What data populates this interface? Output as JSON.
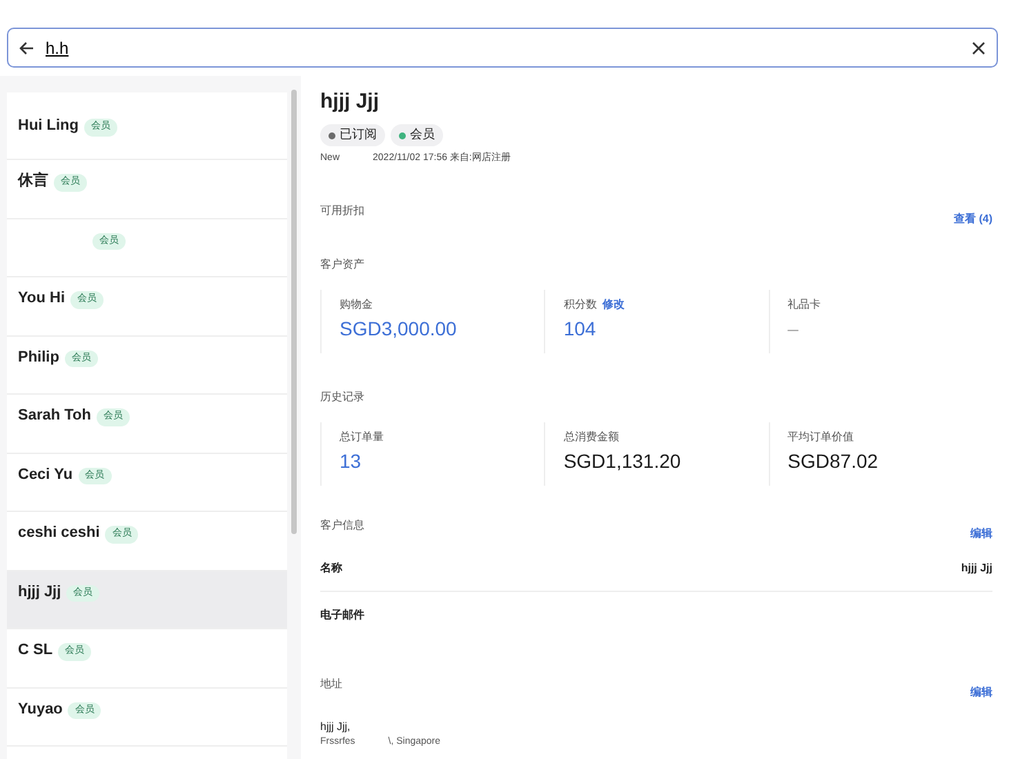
{
  "search": {
    "value": "h.h"
  },
  "customers": [
    {
      "name": "Hui Ling",
      "badge": "会员",
      "selected": false
    },
    {
      "name": "休言",
      "badge": "会员",
      "selected": false
    },
    {
      "badge": "会员",
      "selected": false
    },
    {
      "name": "You Hi",
      "badge": "会员",
      "selected": false
    },
    {
      "name": "Philip",
      "badge": "会员",
      "selected": false
    },
    {
      "name": "Sarah Toh",
      "badge": "会员",
      "selected": false
    },
    {
      "name": "Ceci Yu",
      "badge": "会员",
      "selected": false
    },
    {
      "name": "ceshi ceshi",
      "badge": "会员",
      "selected": false
    },
    {
      "name": "hjjj Jjj",
      "badge": "会员",
      "selected": true
    },
    {
      "name": "C SL",
      "badge": "会员",
      "selected": false
    },
    {
      "name": "Yuyao",
      "badge": "会员",
      "selected": false
    }
  ],
  "detail": {
    "name": "hjjj Jjj",
    "tags": [
      {
        "label": "已订阅",
        "color": "#6b6b6b"
      },
      {
        "label": "会员",
        "color": "#3fb37f"
      }
    ],
    "meta": [
      "New",
      "2022/11/02 17:56 来自:网店注册"
    ],
    "discounts": {
      "title": "可用折扣",
      "link": "查看 (4)"
    },
    "assets": {
      "title": "客户资产",
      "stats": [
        {
          "label": "购物金",
          "value": "SGD3,000.00",
          "highlight": true
        },
        {
          "label": "积分数",
          "link": "修改",
          "value": "104",
          "highlight": true
        },
        {
          "label": "礼品卡",
          "value": "–",
          "highlight": false,
          "muted": true
        }
      ]
    },
    "history": {
      "title": "历史记录",
      "stats": [
        {
          "label": "总订单量",
          "value": "13",
          "highlight": true
        },
        {
          "label": "总消费金额",
          "value": "SGD1,131.20",
          "highlight": false
        },
        {
          "label": "平均订单价值",
          "value": "SGD87.02",
          "highlight": false
        }
      ]
    },
    "info": {
      "title": "客户信息",
      "link": "编辑",
      "rows": [
        {
          "label": "名称",
          "value": "hjjj Jjj"
        },
        {
          "label": "电子邮件"
        }
      ]
    },
    "address": {
      "title": "地址",
      "link": "编辑",
      "name": "hjjj Jjj,",
      "line": [
        "Frssrfes",
        "\\, Singapore"
      ]
    }
  }
}
